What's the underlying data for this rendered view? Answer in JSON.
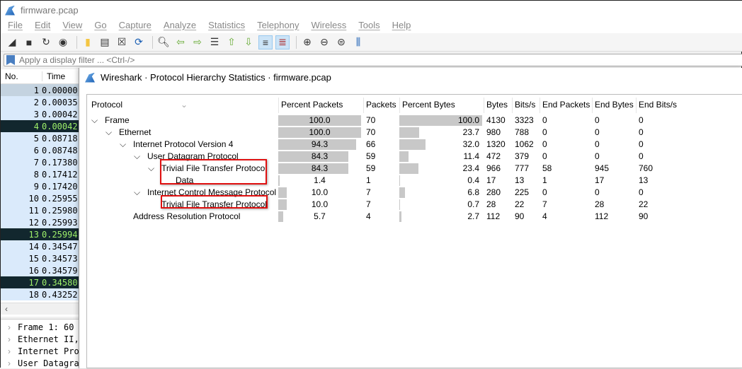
{
  "window": {
    "title": "firmware.pcap"
  },
  "menu": [
    "File",
    "Edit",
    "View",
    "Go",
    "Capture",
    "Analyze",
    "Statistics",
    "Telephony",
    "Wireless",
    "Tools",
    "Help"
  ],
  "filter": {
    "placeholder": "Apply a display filter ... <Ctrl-/>"
  },
  "packet_list": {
    "headers": [
      "No.",
      "Time"
    ],
    "rows": [
      {
        "no": "1",
        "time": "0.00000",
        "style": "sel"
      },
      {
        "no": "2",
        "time": "0.00035",
        "style": ""
      },
      {
        "no": "3",
        "time": "0.00042",
        "style": ""
      },
      {
        "no": "4",
        "time": "0.00042",
        "style": "dark"
      },
      {
        "no": "5",
        "time": "0.08718",
        "style": ""
      },
      {
        "no": "6",
        "time": "0.08748",
        "style": ""
      },
      {
        "no": "7",
        "time": "0.17380",
        "style": ""
      },
      {
        "no": "8",
        "time": "0.17412",
        "style": ""
      },
      {
        "no": "9",
        "time": "0.17420",
        "style": ""
      },
      {
        "no": "10",
        "time": "0.25955",
        "style": ""
      },
      {
        "no": "11",
        "time": "0.25980",
        "style": ""
      },
      {
        "no": "12",
        "time": "0.25993",
        "style": ""
      },
      {
        "no": "13",
        "time": "0.25994",
        "style": "dark"
      },
      {
        "no": "14",
        "time": "0.34547",
        "style": ""
      },
      {
        "no": "15",
        "time": "0.34573",
        "style": ""
      },
      {
        "no": "16",
        "time": "0.34579",
        "style": ""
      },
      {
        "no": "17",
        "time": "0.34580",
        "style": "dark"
      },
      {
        "no": "18",
        "time": "0.43252",
        "style": ""
      }
    ]
  },
  "details": [
    "Frame 1: 60",
    "Ethernet II,",
    "Internet Pro",
    "User Datagra"
  ],
  "dialog": {
    "title": "Wireshark · Protocol Hierarchy Statistics · firmware.pcap",
    "headers": [
      "Protocol",
      "Percent Packets",
      "Packets",
      "Percent Bytes",
      "Bytes",
      "Bits/s",
      "End Packets",
      "End Bytes",
      "End Bits/s"
    ],
    "rows": [
      {
        "protocol": "Frame",
        "depth": 0,
        "expand": true,
        "pct_packets": "100.0",
        "packets": "70",
        "pct_bytes": "100.0",
        "bytes": "4130",
        "bits": "3323",
        "end_packets": "0",
        "end_bytes": "0",
        "end_bits": "0"
      },
      {
        "protocol": "Ethernet",
        "depth": 1,
        "expand": true,
        "pct_packets": "100.0",
        "packets": "70",
        "pct_bytes": "23.7",
        "bytes": "980",
        "bits": "788",
        "end_packets": "0",
        "end_bytes": "0",
        "end_bits": "0"
      },
      {
        "protocol": "Internet Protocol Version 4",
        "depth": 2,
        "expand": true,
        "pct_packets": "94.3",
        "packets": "66",
        "pct_bytes": "32.0",
        "bytes": "1320",
        "bits": "1062",
        "end_packets": "0",
        "end_bytes": "0",
        "end_bits": "0"
      },
      {
        "protocol": "User Datagram Protocol",
        "depth": 3,
        "expand": true,
        "pct_packets": "84.3",
        "packets": "59",
        "pct_bytes": "11.4",
        "bytes": "472",
        "bits": "379",
        "end_packets": "0",
        "end_bytes": "0",
        "end_bits": "0"
      },
      {
        "protocol": "Trivial File Transfer Protocol",
        "depth": 4,
        "expand": true,
        "pct_packets": "84.3",
        "packets": "59",
        "pct_bytes": "23.4",
        "bytes": "966",
        "bits": "777",
        "end_packets": "58",
        "end_bytes": "945",
        "end_bits": "760"
      },
      {
        "protocol": "Data",
        "depth": 5,
        "expand": false,
        "pct_packets": "1.4",
        "packets": "1",
        "pct_bytes": "0.4",
        "bytes": "17",
        "bits": "13",
        "end_packets": "1",
        "end_bytes": "17",
        "end_bits": "13"
      },
      {
        "protocol": "Internet Control Message Protocol",
        "depth": 3,
        "expand": true,
        "pct_packets": "10.0",
        "packets": "7",
        "pct_bytes": "6.8",
        "bytes": "280",
        "bits": "225",
        "end_packets": "0",
        "end_bytes": "0",
        "end_bits": "0"
      },
      {
        "protocol": "Trivial File Transfer Protocol",
        "depth": 4,
        "expand": false,
        "pct_packets": "10.0",
        "packets": "7",
        "pct_bytes": "0.7",
        "bytes": "28",
        "bits": "22",
        "end_packets": "7",
        "end_bytes": "28",
        "end_bits": "22"
      },
      {
        "protocol": "Address Resolution Protocol",
        "depth": 2,
        "expand": false,
        "pct_packets": "5.7",
        "packets": "4",
        "pct_bytes": "2.7",
        "bytes": "112",
        "bits": "90",
        "end_packets": "4",
        "end_bytes": "112",
        "end_bits": "90"
      }
    ]
  },
  "colors": {
    "highlight": "#e01010",
    "bar": "#c8c8c8",
    "packet_row": "#daeafb",
    "dark_row": "#12272e",
    "dark_text": "#9ef06a"
  }
}
